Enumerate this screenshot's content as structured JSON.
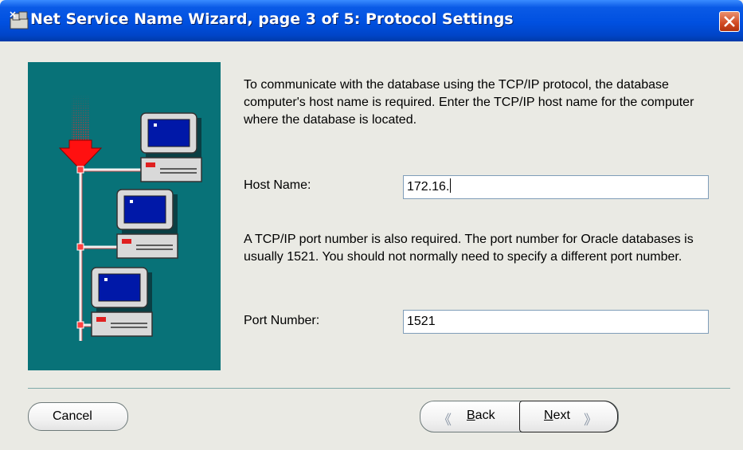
{
  "window": {
    "title": "Net Service Name Wizard, page 3 of 5: Protocol Settings",
    "icon": "wizard-app-icon",
    "close_icon": "close-icon"
  },
  "illustration": {
    "icon": "network-computers-illustration",
    "background": "#087278"
  },
  "content": {
    "host_description": "To communicate with the database using the TCP/IP protocol, the database computer's host name is required.  Enter the TCP/IP host name for the computer where the database is located.",
    "host_label": "Host Name:",
    "host_value": "172.16.",
    "port_description": "A TCP/IP port number is also required.  The port number for Oracle databases is usually 1521.  You should not normally need to specify a different port number.",
    "port_label": "Port Number:",
    "port_value": "1521"
  },
  "buttons": {
    "cancel": "Cancel",
    "back_mnemonic": "B",
    "back_rest": "ack",
    "next_mnemonic": "N",
    "next_rest": "ext",
    "back_icon": "chevron-left-icon",
    "next_icon": "chevron-right-icon"
  }
}
